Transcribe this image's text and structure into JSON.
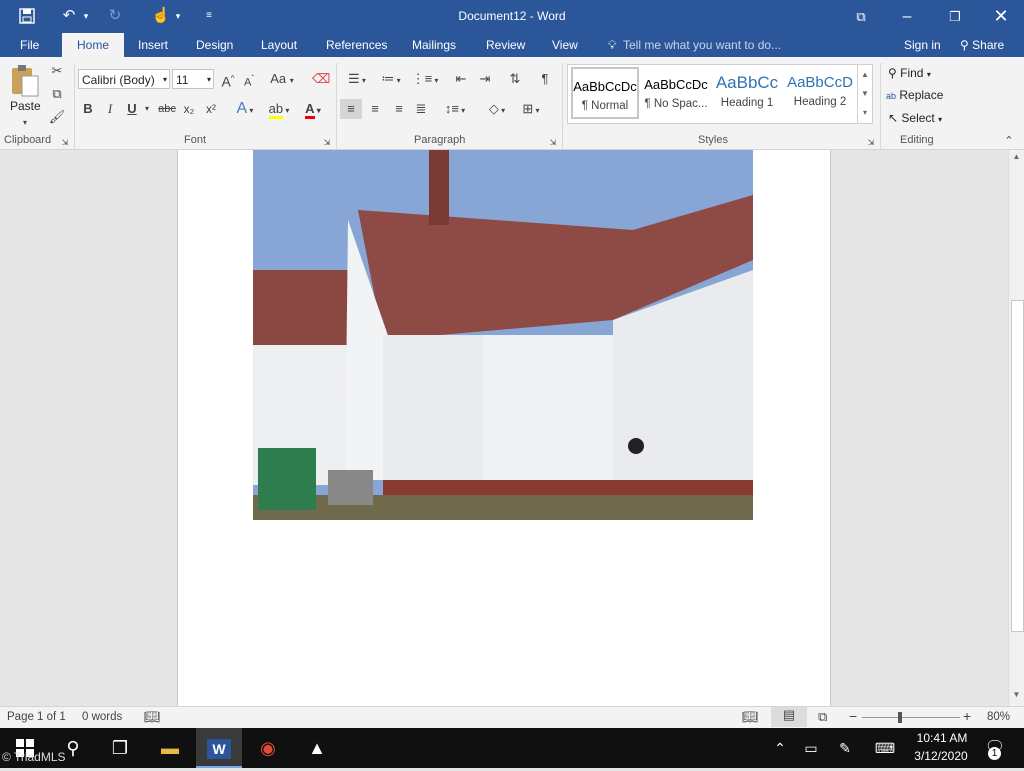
{
  "window": {
    "title": "Document12 - Word"
  },
  "quick_access": {
    "save_icon": "save-icon",
    "undo_icon": "undo-icon",
    "redo_icon": "redo-icon",
    "touch_icon": "touch-mode-icon",
    "customize_icon": "customize-icon"
  },
  "tabs": [
    "File",
    "Home",
    "Insert",
    "Design",
    "Layout",
    "References",
    "Mailings",
    "Review",
    "View"
  ],
  "active_tab": "Home",
  "tell_me": {
    "placeholder": "Tell me what you want to do..."
  },
  "account": {
    "sign_in": "Sign in",
    "share": "Share"
  },
  "clipboard": {
    "paste": "Paste",
    "label": "Clipboard"
  },
  "font": {
    "family": "Calibri (Body)",
    "size": "11",
    "label": "Font",
    "grow": "A",
    "shrink": "A",
    "case": "Aa",
    "bold": "B",
    "italic": "I",
    "underline": "U",
    "strike": "abc",
    "sub": "x₂",
    "sup": "x²"
  },
  "paragraph": {
    "label": "Paragraph"
  },
  "styles": {
    "label": "Styles",
    "items": [
      {
        "preview": "AaBbCcDc",
        "name": "¶ Normal",
        "color": "#000000"
      },
      {
        "preview": "AaBbCcDc",
        "name": "¶ No Spac...",
        "color": "#000000"
      },
      {
        "preview": "AaBbCc",
        "name": "Heading 1",
        "color": "#2e74b5"
      },
      {
        "preview": "AaBbCcD",
        "name": "Heading 2",
        "color": "#2e74b5"
      }
    ]
  },
  "editing": {
    "find": "Find",
    "replace": "Replace",
    "select": "Select",
    "label": "Editing"
  },
  "document": {
    "image": "house-photo"
  },
  "status": {
    "page": "Page 1 of 1",
    "words": "0 words",
    "zoom": "80%"
  },
  "taskbar": {
    "time": "10:41 AM",
    "date": "3/12/2020",
    "notifications": "1"
  },
  "watermark": "© TriadMLS",
  "colors": {
    "accent": "#2b579a",
    "ribbon": "#f3f3f3",
    "taskbar": "#101010"
  }
}
